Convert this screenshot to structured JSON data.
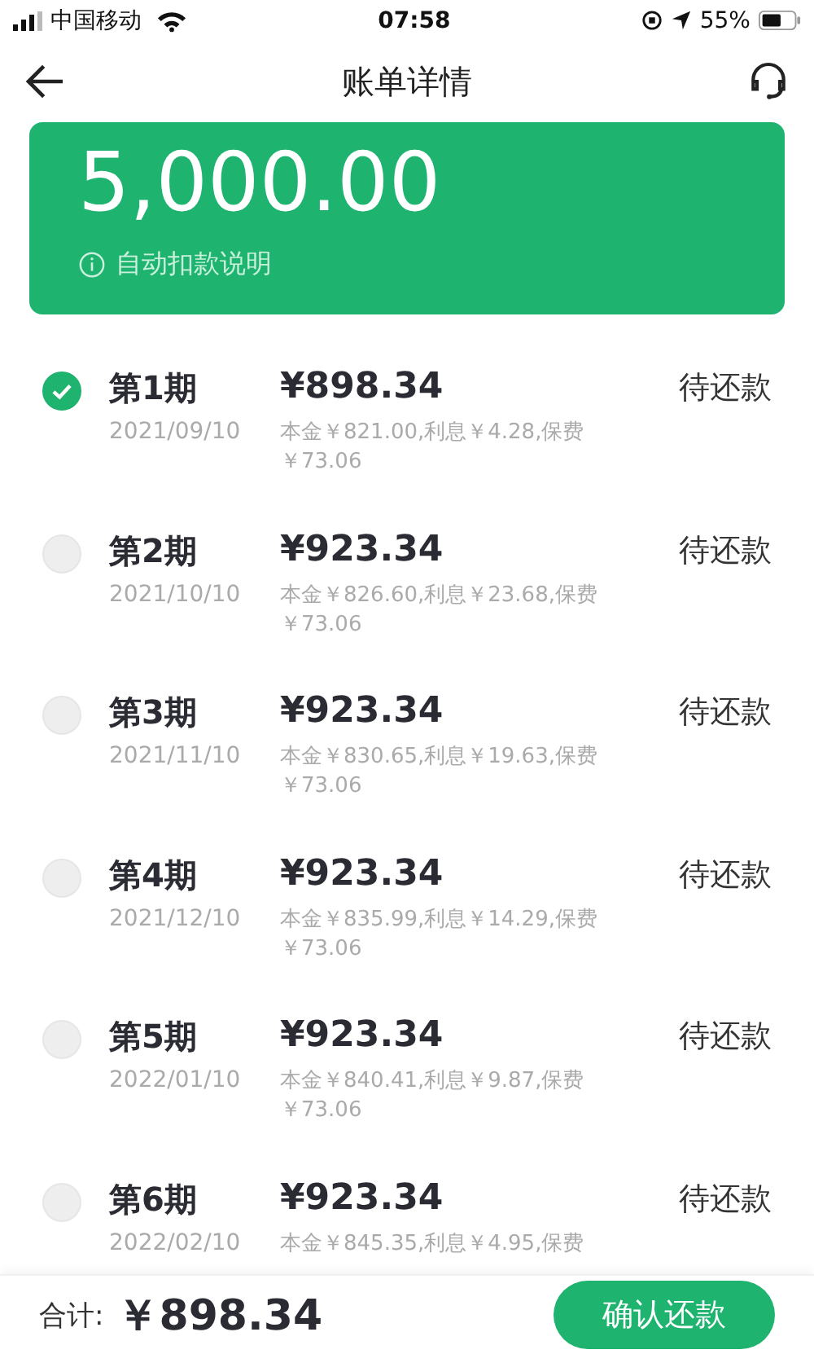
{
  "status_bar": {
    "carrier": "中国移动",
    "time": "07:58",
    "battery": "55%"
  },
  "header": {
    "title": "账单详情"
  },
  "summary": {
    "amount": "5,000.00",
    "note": "自动扣款说明"
  },
  "installments": [
    {
      "period": "第1期",
      "date": "2021/09/10",
      "amount": "¥898.34",
      "detail": "本金￥821.00,利息￥4.28,保费￥73.06",
      "status": "待还款",
      "selected": true
    },
    {
      "period": "第2期",
      "date": "2021/10/10",
      "amount": "¥923.34",
      "detail": "本金￥826.60,利息￥23.68,保费￥73.06",
      "status": "待还款",
      "selected": false
    },
    {
      "period": "第3期",
      "date": "2021/11/10",
      "amount": "¥923.34",
      "detail": "本金￥830.65,利息￥19.63,保费￥73.06",
      "status": "待还款",
      "selected": false
    },
    {
      "period": "第4期",
      "date": "2021/12/10",
      "amount": "¥923.34",
      "detail": "本金￥835.99,利息￥14.29,保费￥73.06",
      "status": "待还款",
      "selected": false
    },
    {
      "period": "第5期",
      "date": "2022/01/10",
      "amount": "¥923.34",
      "detail": "本金￥840.41,利息￥9.87,保费￥73.06",
      "status": "待还款",
      "selected": false
    },
    {
      "period": "第6期",
      "date": "2022/02/10",
      "amount": "¥923.34",
      "detail": "本金￥845.35,利息￥4.95,保费",
      "status": "待还款",
      "selected": false
    }
  ],
  "footer": {
    "total_label": "合计:",
    "total": "￥898.34",
    "button": "确认还款"
  }
}
